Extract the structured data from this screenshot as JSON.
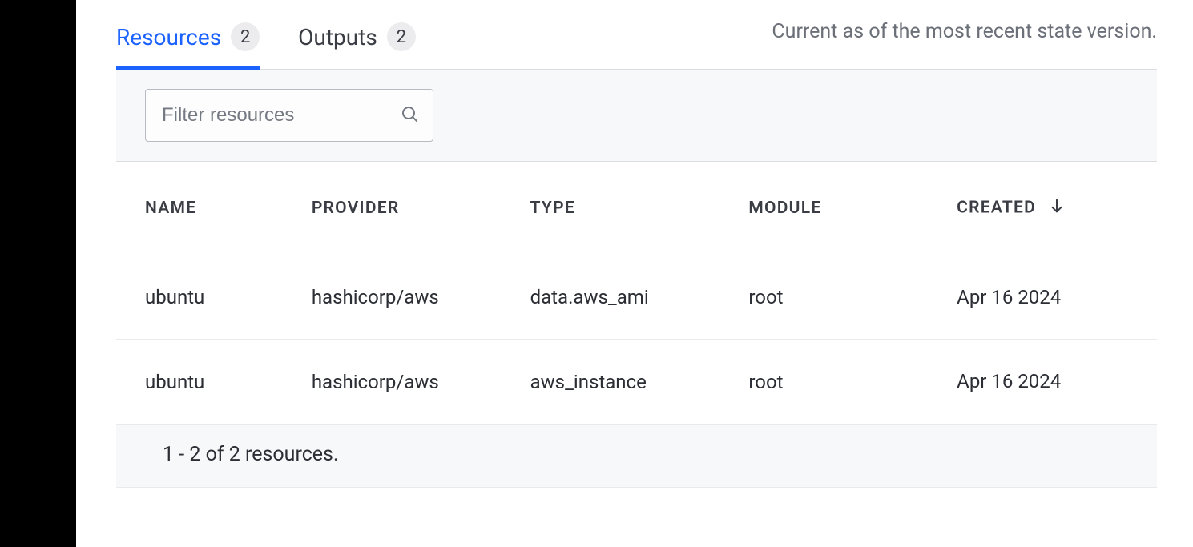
{
  "status_note": "Current as of the most recent state version.",
  "tabs": [
    {
      "label": "Resources",
      "count": "2",
      "active": true
    },
    {
      "label": "Outputs",
      "count": "2",
      "active": false
    }
  ],
  "filter": {
    "placeholder": "Filter resources"
  },
  "columns": {
    "name": "NAME",
    "provider": "PROVIDER",
    "type": "TYPE",
    "module": "MODULE",
    "created": "CREATED"
  },
  "rows": [
    {
      "name": "ubuntu",
      "provider": "hashicorp/aws",
      "type": "data.aws_ami",
      "module": "root",
      "created": "Apr 16 2024"
    },
    {
      "name": "ubuntu",
      "provider": "hashicorp/aws",
      "type": "aws_instance",
      "module": "root",
      "created": "Apr 16 2024"
    }
  ],
  "footer": "1 - 2 of 2 resources."
}
